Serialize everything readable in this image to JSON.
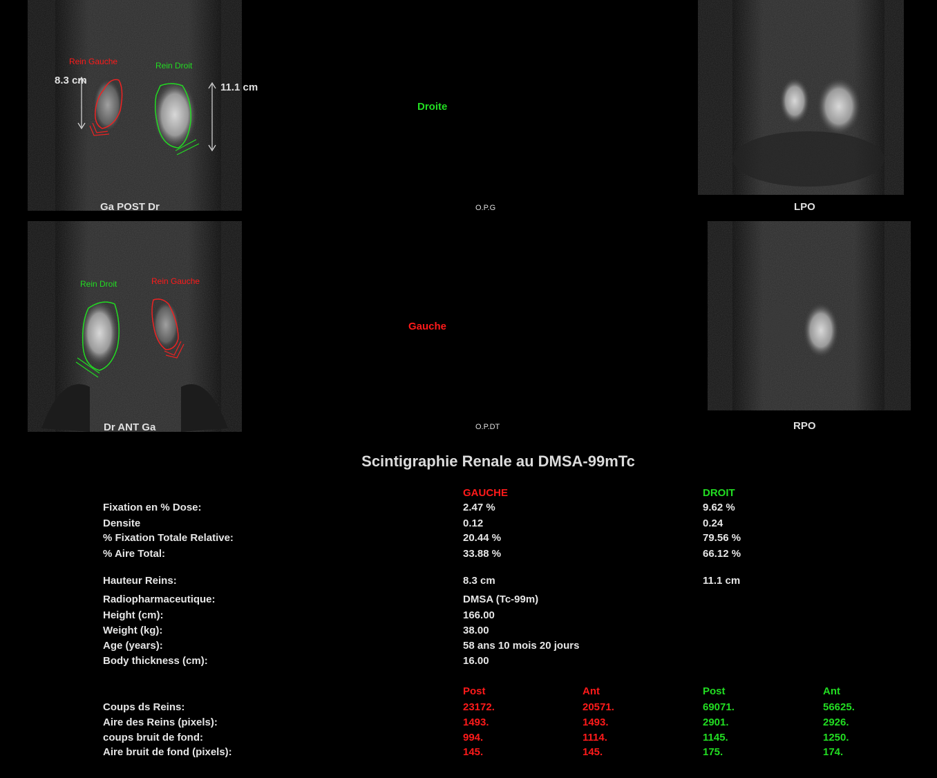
{
  "views": {
    "post": {
      "caption": "Ga  POST  Dr",
      "roi_left_label": "Rein Gauche",
      "roi_right_label": "Rein Droit",
      "left_height": "8.3 cm",
      "right_height": "11.1 cm"
    },
    "ant": {
      "caption": "Dr  ANT  Ga",
      "roi_left_label": "Rein Droit",
      "roi_right_label": "Rein Gauche"
    },
    "opg": {
      "side_label": "Droite",
      "caption": "O.P.G"
    },
    "opdt": {
      "side_label": "Gauche",
      "caption": "O.P.DT"
    },
    "lpo": {
      "caption": "LPO"
    },
    "rpo": {
      "caption": "RPO"
    }
  },
  "report": {
    "title": "Scintigraphie Renale au DMSA-99mTc",
    "col_gauche": "GAUCHE",
    "col_droit": "DROIT",
    "rows1": [
      {
        "label": "Fixation en % Dose:",
        "gauche": "2.47 %",
        "droit": "9.62 %"
      },
      {
        "label": "Densite",
        "gauche": "0.12",
        "droit": "0.24"
      },
      {
        "label": "% Fixation Totale Relative:",
        "gauche": "20.44 %",
        "droit": "79.56 %"
      },
      {
        "label": "% Aire Total:",
        "gauche": "33.88 %",
        "droit": "66.12 %"
      }
    ],
    "hauteur": {
      "label": "Hauteur Reins:",
      "gauche": "8.3 cm",
      "droit": "11.1 cm"
    },
    "rows2": [
      {
        "label": "Radiopharmaceutique:",
        "value": "DMSA  (Tc-99m)"
      },
      {
        "label": "Height  (cm):",
        "value": "166.00"
      },
      {
        "label": "Weight  (kg):",
        "value": "38.00"
      },
      {
        "label": "Age (years):",
        "value": "58 ans 10 mois 20 jours"
      },
      {
        "label": "Body thickness (cm):",
        "value": "16.00"
      }
    ],
    "counts_headers": {
      "g_post": "Post",
      "g_ant": "Ant",
      "d_post": "Post",
      "d_ant": "Ant"
    },
    "counts": [
      {
        "label": "Coups ds Reins:",
        "g_post": "23172.",
        "g_ant": "20571.",
        "d_post": "69071.",
        "d_ant": "56625."
      },
      {
        "label": "Aire des Reins (pixels):",
        "g_post": "1493.",
        "g_ant": "1493.",
        "d_post": "2901.",
        "d_ant": "2926."
      },
      {
        "label": "coups bruit de fond:",
        "g_post": "994.",
        "g_ant": "1114.",
        "d_post": "1145.",
        "d_ant": "1250."
      },
      {
        "label": "Aire bruit de fond (pixels):",
        "g_post": "145.",
        "g_ant": "145.",
        "d_post": "175.",
        "d_ant": "174."
      }
    ]
  },
  "colors": {
    "gauche": "#ff1a1a",
    "droit": "#22dd22",
    "background": "#000000"
  }
}
